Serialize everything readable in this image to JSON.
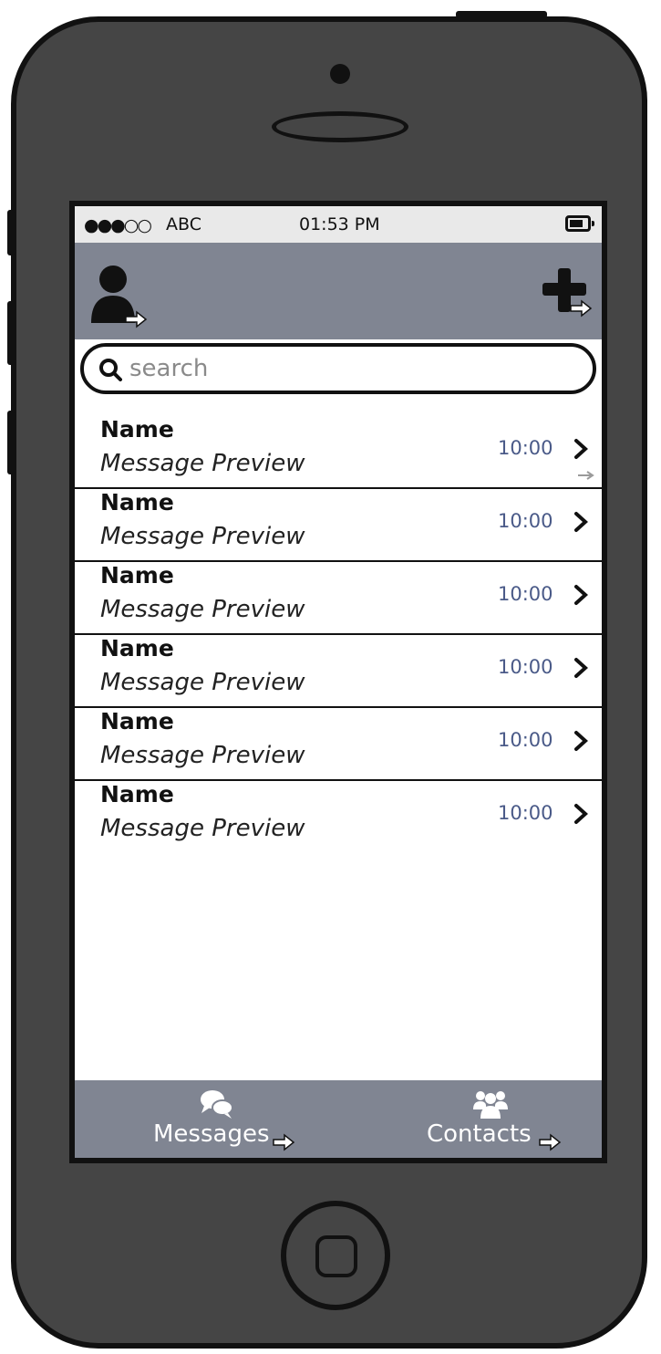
{
  "status_bar": {
    "signal": "●●●○○",
    "carrier": "ABC",
    "time": "01:53 PM"
  },
  "nav": {
    "profile_icon": "user-icon",
    "add_icon": "plus-icon"
  },
  "search": {
    "placeholder": "search",
    "value": ""
  },
  "messages": [
    {
      "name": "Name",
      "preview": "Message Preview",
      "time": "10:00"
    },
    {
      "name": "Name",
      "preview": "Message Preview",
      "time": "10:00"
    },
    {
      "name": "Name",
      "preview": "Message Preview",
      "time": "10:00"
    },
    {
      "name": "Name",
      "preview": "Message Preview",
      "time": "10:00"
    },
    {
      "name": "Name",
      "preview": "Message Preview",
      "time": "10:00"
    },
    {
      "name": "Name",
      "preview": "Message Preview",
      "time": "10:00"
    }
  ],
  "tabs": [
    {
      "label": "Messages",
      "icon": "chat-bubbles-icon"
    },
    {
      "label": "Contacts",
      "icon": "people-icon"
    }
  ],
  "colors": {
    "phone_body": "#454545",
    "bar_gray": "#808592",
    "time_blue": "#4a5a88"
  }
}
